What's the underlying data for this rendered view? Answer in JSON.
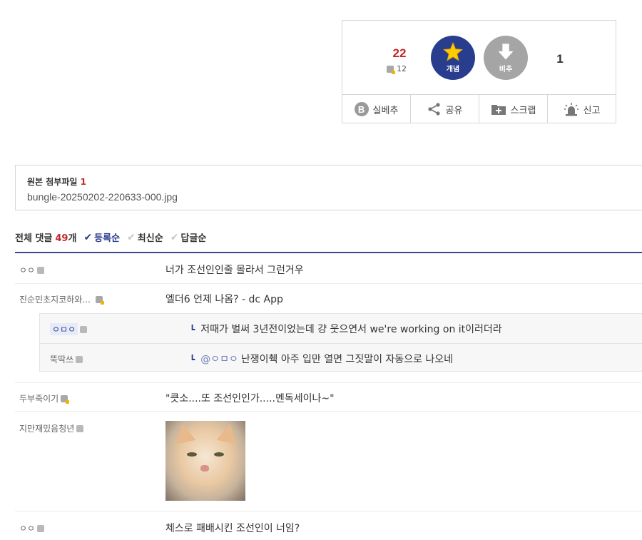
{
  "recommend": {
    "up_count": "22",
    "fixed_count": "12",
    "up_label": "개념",
    "down_label": "비추",
    "down_count": "1",
    "actions": [
      {
        "label": "실베추",
        "icon": "b-circle-icon"
      },
      {
        "label": "공유",
        "icon": "share-icon"
      },
      {
        "label": "스크랩",
        "icon": "scrap-folder-icon"
      },
      {
        "label": "신고",
        "icon": "siren-icon"
      }
    ]
  },
  "attachment": {
    "title": "원본 첨부파일",
    "count": "1",
    "filename": "bungle-20250202-220633-000.jpg"
  },
  "comments_header": {
    "label": "전체 댓글",
    "count": "49",
    "unit": "개",
    "sorts": [
      "등록순",
      "최신순",
      "답글순"
    ],
    "active_sort": "등록순"
  },
  "comments": [
    {
      "nick": "ㅇㅇ",
      "text": "너가 조선인인줄 몰라서 그런거우"
    },
    {
      "nick": "진순민초지코하와...",
      "text": "엘더6 언제 나옴? - dc App"
    },
    {
      "nick": "두부죽이기",
      "text": "\"큿소....또 조선인인가.....멘독세이나~\""
    },
    {
      "nick": "지만재밌음청년",
      "text": ""
    },
    {
      "nick": "ㅇㅇ",
      "text": "체스로 패배시킨 조선인이 너임?"
    }
  ],
  "replies": [
    {
      "nick": "ㅇㅁㅇ",
      "text": "저때가 벌써 3년전이었는데 걍 웃으연서 we're working on it이러더라"
    },
    {
      "nick": "뚝딱쓰",
      "mention": "@ㅇㅁㅇ",
      "text": "난쟁이췍 아주 입만 열면 그짓말이 자동으로 나오네"
    }
  ]
}
